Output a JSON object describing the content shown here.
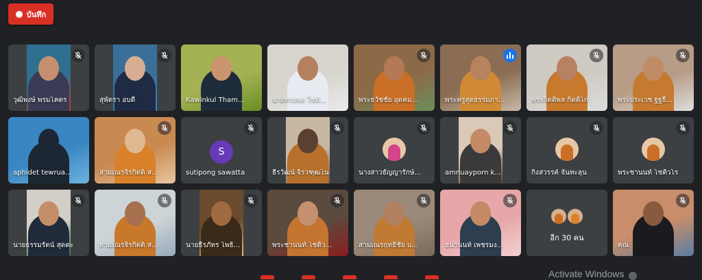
{
  "record_button": {
    "label": "บันทึก"
  },
  "participants": [
    {
      "name": "วุฒิพงษ์ พรมโคตร",
      "muted": true,
      "bg": "#2f6f8f",
      "fig": "#3b3b55",
      "skin": "#c69070",
      "layout": "mid",
      "accent": "#c0392b"
    },
    {
      "name": "สุพัตรา อบดี",
      "muted": true,
      "bg": "#3a6f99",
      "fig": "#1f2b44",
      "skin": "#d8ae92",
      "layout": "mid",
      "accent": "#2e86c1"
    },
    {
      "name": "Kawinkul Tham...",
      "muted": false,
      "bg": "#a4b254",
      "fig": "#1d2b3a",
      "skin": "#c9946e",
      "layout": "full",
      "accent": "#6b8e23"
    },
    {
      "name": "นายทรงพล โชติ...",
      "muted": false,
      "bg": "#d8d5cf",
      "fig": "#e8ecf2",
      "skin": "#b58060",
      "layout": "full",
      "accent": "#eaeaea"
    },
    {
      "name": "พระธวัชชัย อุดคม...",
      "muted": true,
      "bg": "#8c6a48",
      "fig": "#c97026",
      "skin": "#b37a55",
      "layout": "full",
      "accent": "#6b8e5a"
    },
    {
      "name": "พระครูสุตธรรมภา...",
      "muted": false,
      "speaking": true,
      "bg": "#8a6d52",
      "fig": "#d08a36",
      "skin": "#b7825d",
      "layout": "full",
      "accent": "#c8b9a6"
    },
    {
      "name": "พระกิตติพล กิตติโก",
      "muted": true,
      "bg": "#cfcac2",
      "fig": "#c77a2e",
      "skin": "#b98163",
      "layout": "full",
      "accent": "#ddd"
    },
    {
      "name": "พระประเวช ฐฐธี...",
      "muted": true,
      "bg": "#b79c86",
      "fig": "#c67a30",
      "skin": "#c08c66",
      "layout": "full",
      "accent": "#ddd"
    },
    {
      "name": "aphidet tewrua...",
      "muted": false,
      "bg": "#3a86c2",
      "fig": "#1c2733",
      "skin": "#1c2733",
      "layout": "full",
      "accent": "#69b3e0"
    },
    {
      "name": "สามเณรจิรกิตติ์ ส...",
      "muted": true,
      "bg": "#c98a52",
      "fig": "#d9822b",
      "skin": "#e0b892",
      "layout": "full",
      "accent": "#e7c6a0"
    },
    {
      "name": "sutipong sawatta",
      "muted": true,
      "letter": "S"
    },
    {
      "name": "ธีรวัฒน์ จิรวฑฺฒโน",
      "muted": true,
      "bg": "#c8b8a3",
      "fig": "#b8712c",
      "skin": "#5a4030",
      "layout": "mid",
      "accent": "#7a5a3c"
    },
    {
      "name": "นางสาวธัญญารักษ์...",
      "muted": true,
      "photo": "#d4458a"
    },
    {
      "name": "amnuayporn k...",
      "muted": true,
      "bg": "#d9c9b6",
      "fig": "#3a3a3a",
      "skin": "#c48a65",
      "layout": "mid",
      "accent": "#5a4a3a"
    },
    {
      "name": "กิ่งสวรรค์ จันทะลุน",
      "muted": true,
      "photo": "#c97026"
    },
    {
      "name": "พระชานนท์ โชติวโร",
      "muted": true,
      "photo": "#c97026"
    },
    {
      "name": "นายธรรมรัตน์ สุดตะ",
      "muted": true,
      "bg": "#d2cfc6",
      "fig": "#1f2a3a",
      "skin": "#c48d6a",
      "layout": "mid",
      "accent": "#3a6b4a"
    },
    {
      "name": "สามเณรจิรกิตติ์ ส...",
      "muted": true,
      "bg": "#cdd4d6",
      "fig": "#c7782b",
      "skin": "#a6704f",
      "layout": "full",
      "accent": "#9ab"
    },
    {
      "name": "นายธีรภัทร โพธิ์...",
      "muted": true,
      "bg": "#6b4a2e",
      "fig": "#3a2a1a",
      "skin": "#a06a40",
      "layout": "mid",
      "accent": "#e8c37a"
    },
    {
      "name": "พระชานนท์ โชติว...",
      "muted": true,
      "bg": "#5b4a3e",
      "fig": "#c47530",
      "skin": "#c49070",
      "layout": "full",
      "accent": "#8b1e1e"
    },
    {
      "name": "สามเณรฤทธิชัย แ...",
      "muted": true,
      "bg": "#9b8a7a",
      "fig": "#c07a34",
      "skin": "#b08060",
      "layout": "full",
      "accent": "#7a6a5a"
    },
    {
      "name": "ธนานนท์ เพชรมง...",
      "muted": true,
      "bg": "#e7a6a8",
      "fig": "#2c3e50",
      "skin": "#c48a65",
      "layout": "full",
      "accent": "#f2d0d0"
    },
    {
      "name": "อีก 30 คน",
      "more": true
    },
    {
      "name": "คุณ",
      "muted": true,
      "bg": "#c88d6a",
      "fig": "#1b1b1f",
      "skin": "#8a5a3e",
      "layout": "full",
      "accent": "#5a7ea3"
    }
  ],
  "watermark": {
    "text": "Activate Windows"
  }
}
